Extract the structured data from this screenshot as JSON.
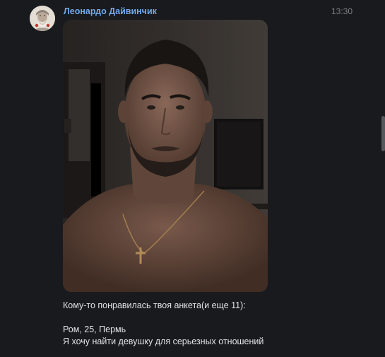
{
  "message": {
    "sender": "Леонардо Дайвинчик",
    "time": "13:30",
    "avatar_icon": "bearded-man-portrait",
    "photo_icon": "profile-photo-shirtless-man",
    "text": {
      "line1": "Кому-то понравилась твоя анкета(и еще 11):",
      "line2": "Ром, 25, Пермь",
      "line3": "Я хочу найти девушку для серьезных отношений"
    }
  },
  "colors": {
    "background": "#191a1d",
    "sender": "#71aaeb",
    "text": "#e1e3e6",
    "time": "#7b7f86"
  }
}
